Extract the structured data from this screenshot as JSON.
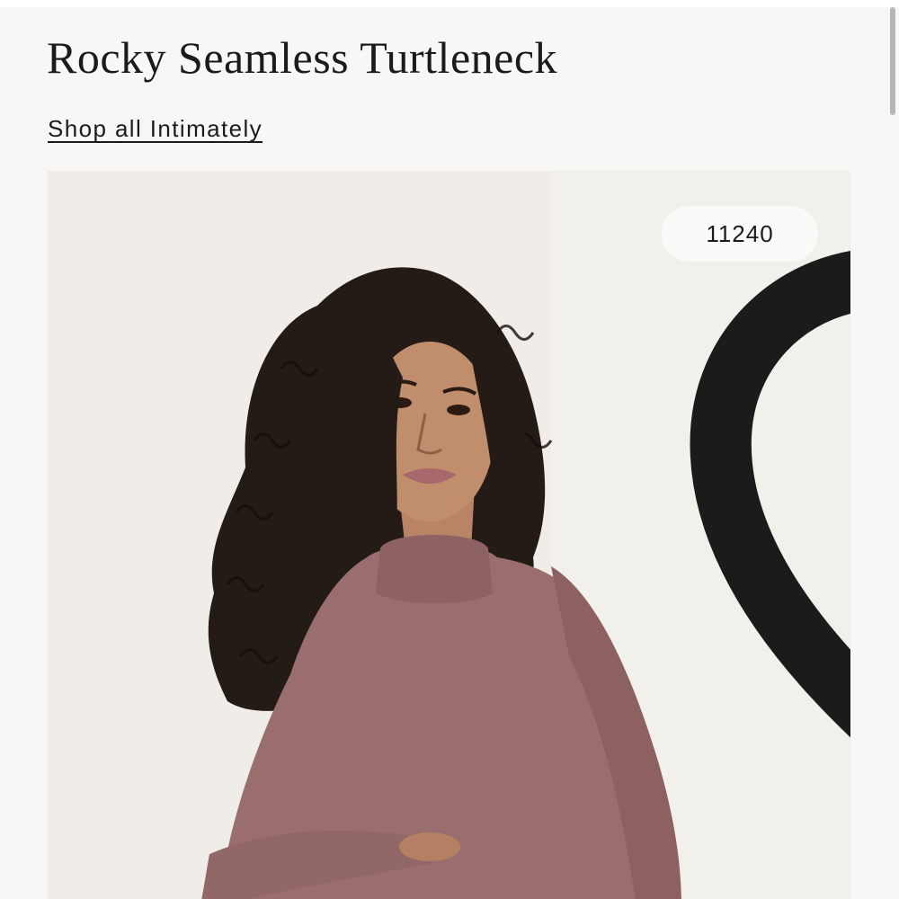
{
  "product": {
    "title": "Rocky Seamless Turtleneck",
    "shop_all_link": "Shop all Intimately"
  },
  "gallery": {
    "likes_count": "11240",
    "like_icon": "heart-outline-icon",
    "image_subject": "model-in-mauve-turtleneck"
  },
  "colors": {
    "page_background": "#f9f7f5",
    "photo_background": "#efece6",
    "garment": "#9a6e6e",
    "text": "#1b1b1b"
  }
}
